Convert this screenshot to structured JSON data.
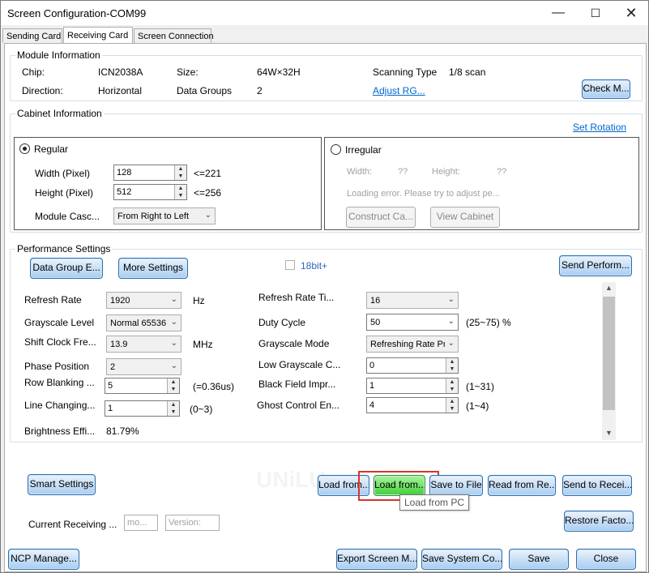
{
  "window": {
    "title": "Screen Configuration-COM99"
  },
  "tabs": [
    {
      "label": "Sending Card"
    },
    {
      "label": "Receiving Card"
    },
    {
      "label": "Screen Connection"
    }
  ],
  "module": {
    "title": "Module Information",
    "chip_label": "Chip:",
    "chip_value": "ICN2038A",
    "size_label": "Size:",
    "size_value": "64W×32H",
    "scan_label": "Scanning Type",
    "scan_value": "1/8 scan",
    "direction_label": "Direction:",
    "direction_value": "Horizontal",
    "groups_label": "Data Groups",
    "groups_value": "2",
    "adjust_link": "Adjust RG...",
    "check_button": "Check M..."
  },
  "cabinet": {
    "title": "Cabinet Information",
    "set_rotation": "Set Rotation",
    "regular_label": "Regular",
    "width_label": "Width (Pixel)",
    "width_value": "128",
    "width_limit": "<=221",
    "height_label": "Height (Pixel)",
    "height_value": "512",
    "height_limit": "<=256",
    "cascade_label": "Module Casc...",
    "cascade_value": "From Right to Left",
    "irregular_label": "Irregular",
    "irr_width_label": "Width:",
    "irr_width_value": "??",
    "irr_height_label": "Height:",
    "irr_height_value": "??",
    "loading_error": "Loading error. Please try to adjust pe...",
    "construct_button": "Construct Ca...",
    "view_button": "View Cabinet"
  },
  "performance": {
    "title": "Performance Settings",
    "data_group_button": "Data Group E...",
    "more_settings_button": "More Settings",
    "bit_label": "18bit+",
    "send_perform_button": "Send Perform...",
    "refresh_rate_label": "Refresh Rate",
    "refresh_rate_value": "1920",
    "refresh_rate_unit": "Hz",
    "grayscale_level_label": "Grayscale Level",
    "grayscale_level_value": "Normal 65536",
    "shift_clock_label": "Shift Clock Fre...",
    "shift_clock_value": "13.9",
    "shift_clock_unit": "MHz",
    "phase_label": "Phase Position",
    "phase_value": "2",
    "row_blanking_label": "Row Blanking ...",
    "row_blanking_value": "5",
    "row_blanking_note": "(=0.36us)",
    "line_changing_label": "Line Changing...",
    "line_changing_value": "1",
    "line_changing_note": "(0~3)",
    "brightness_label": "Brightness Effi...",
    "brightness_value": "81.79%",
    "refresh_times_label": "Refresh Rate Ti...",
    "refresh_times_value": "16",
    "duty_label": "Duty Cycle",
    "duty_value": "50",
    "duty_note": "(25~75) %",
    "grayscale_mode_label": "Grayscale Mode",
    "grayscale_mode_value": "Refreshing Rate Pri",
    "low_gray_label": "Low Grayscale C...",
    "low_gray_value": "0",
    "black_field_label": "Black Field Impr...",
    "black_field_value": "1",
    "black_field_note": "(1~31)",
    "ghost_label": "Ghost Control En...",
    "ghost_value": "4",
    "ghost_note": "(1~4)"
  },
  "actions": {
    "smart_settings": "Smart Settings",
    "load_from_1": "Load from...",
    "load_from_2": "Load from...",
    "save_to_file": "Save to File",
    "read_from": "Read from Re...",
    "send_to": "Send to Recei...",
    "tooltip": "Load from PC",
    "restore": "Restore Facto...",
    "current_receiving_label": "Current Receiving ...",
    "current_receiving_value": "mo...",
    "version_placeholder": "Version:",
    "watermark": "UNiLU"
  },
  "footer": {
    "ncp": "NCP Manage...",
    "export": "Export Screen M...",
    "save_system": "Save System Co...",
    "save": "Save",
    "close": "Close"
  }
}
